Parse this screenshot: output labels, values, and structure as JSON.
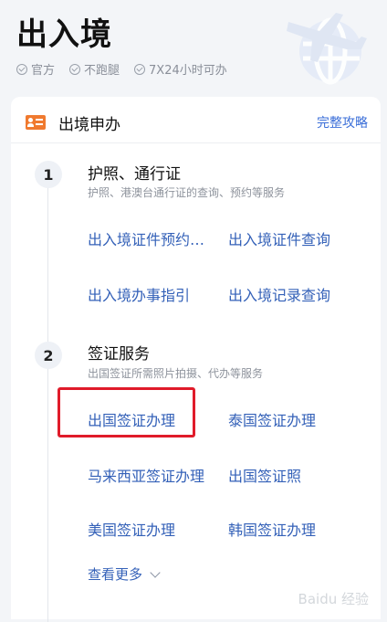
{
  "header": {
    "title": "出入境",
    "features": [
      "官方",
      "不跑腿",
      "7X24小时可办"
    ]
  },
  "card": {
    "title": "出境申办",
    "guide_link": "完整攻略",
    "sections": [
      {
        "number": "1",
        "title": "护照、通行证",
        "subtitle": "护照、港澳台通行证的查询、预约等服务",
        "services": [
          "出入境证件预约…",
          "出入境证件查询",
          "出入境办事指引",
          "出入境记录查询"
        ]
      },
      {
        "number": "2",
        "title": "签证服务",
        "subtitle": "出国签证所需照片拍摄、代办等服务",
        "services": [
          "出国签证办理",
          "泰国签证办理",
          "马来西亚签证办理",
          "出国签证照",
          "美国签证办理",
          "韩国签证办理"
        ]
      }
    ],
    "more_label": "查看更多"
  },
  "watermark": "Baidu 经验",
  "colors": {
    "accent": "#3461b8",
    "highlight": "#e01b2a",
    "id_icon": "#f07a2f"
  }
}
